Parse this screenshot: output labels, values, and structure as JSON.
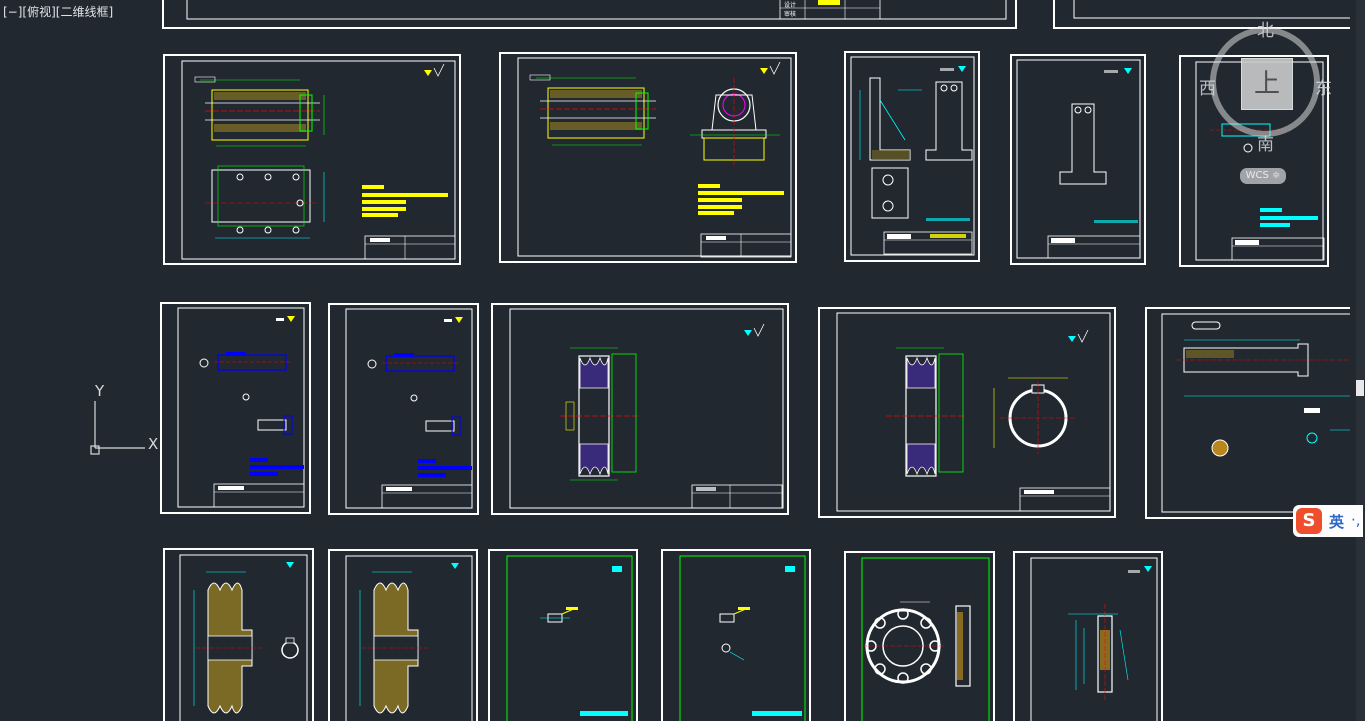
{
  "viewport": {
    "label": "[−][俯视][二维线框]"
  },
  "ucs": {
    "x_label": "X",
    "y_label": "Y"
  },
  "viewcube": {
    "north": "北",
    "south": "南",
    "east": "东",
    "west": "西",
    "top_face": "上",
    "wcs_label": "WCS ≑"
  },
  "title_block_top": {
    "row1": "设计",
    "row2": "审核"
  },
  "ime": {
    "logo": "S",
    "lang": "英",
    "punct": "·,"
  },
  "sheets": [
    {
      "id": "sheet-shaft-assembly",
      "kind": "shaft"
    },
    {
      "id": "sheet-bearing-seat",
      "kind": "shaft-seat"
    },
    {
      "id": "sheet-bracket-1",
      "kind": "bracket"
    },
    {
      "id": "sheet-bracket-2",
      "kind": "column"
    },
    {
      "id": "sheet-small-shaft",
      "kind": "small"
    },
    {
      "id": "sheet-pin-1",
      "kind": "pin"
    },
    {
      "id": "sheet-pin-2",
      "kind": "pin"
    },
    {
      "id": "sheet-pulley-1",
      "kind": "pulley"
    },
    {
      "id": "sheet-pulley-2",
      "kind": "pulley-ring"
    },
    {
      "id": "sheet-long-shaft",
      "kind": "longshaft"
    },
    {
      "id": "sheet-pulley-hatched-1",
      "kind": "pulley-hatch"
    },
    {
      "id": "sheet-pulley-hatched-2",
      "kind": "pulley-hatch"
    },
    {
      "id": "sheet-part-green-1",
      "kind": "green"
    },
    {
      "id": "sheet-part-green-2",
      "kind": "green"
    },
    {
      "id": "sheet-flange",
      "kind": "flange"
    },
    {
      "id": "sheet-spindle",
      "kind": "spindle"
    }
  ],
  "colors": {
    "background": "#212830",
    "sheet_border": "#ffffff",
    "yellow": "#ffff00",
    "cyan": "#00ffff",
    "green": "#00ff00",
    "red": "#ff0000",
    "blue": "#0000ff",
    "magenta": "#ff00ff"
  }
}
